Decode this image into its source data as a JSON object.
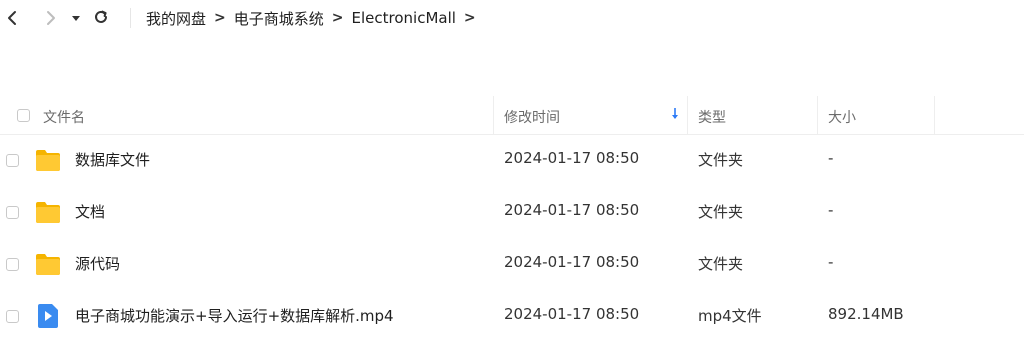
{
  "toolbar": {
    "back_icon": "chevron-left-icon",
    "forward_icon": "chevron-right-icon",
    "history_icon": "caret-down-icon",
    "refresh_icon": "refresh-icon"
  },
  "breadcrumb": [
    "我的网盘",
    "电子商城系统",
    "ElectronicMall"
  ],
  "table": {
    "headers": {
      "name": "文件名",
      "modified": "修改时间",
      "type": "类型",
      "size": "大小"
    },
    "sort_icon": "sort-down-arrow-icon",
    "rows": [
      {
        "icon": "folder-icon",
        "name": "数据库文件",
        "modified": "2024-01-17 08:50",
        "type": "文件夹",
        "size": "-"
      },
      {
        "icon": "folder-icon",
        "name": "文档",
        "modified": "2024-01-17 08:50",
        "type": "文件夹",
        "size": "-"
      },
      {
        "icon": "folder-icon",
        "name": "源代码",
        "modified": "2024-01-17 08:50",
        "type": "文件夹",
        "size": "-"
      },
      {
        "icon": "video-file-icon",
        "name": "电子商城功能演示+导入运行+数据库解析.mp4",
        "modified": "2024-01-17 08:50",
        "type": "mp4文件",
        "size": "892.14MB"
      }
    ]
  },
  "colors": {
    "folder": "#F7C226",
    "video": "#3A8BF0",
    "sort_accent": "#2E7BF6",
    "border": "#EEEEEE"
  }
}
